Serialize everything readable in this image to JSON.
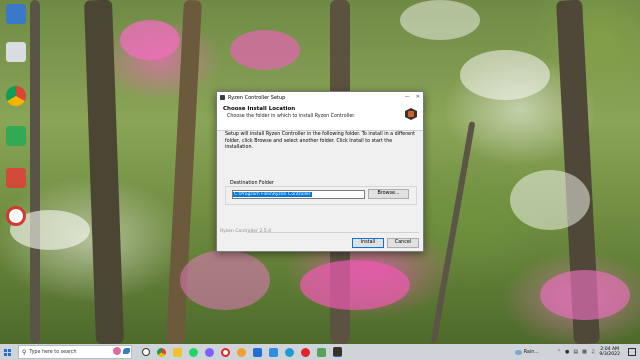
{
  "dialog": {
    "window_title": "Ryzen Controller Setup",
    "header_title": "Choose Install Location",
    "header_subtitle": "Choose the folder in which to install Ryzen Controller.",
    "body_text": "Setup will install Ryzen Controller in the following folder. To install in a different folder, click Browse and select another folder. Click Install to start the installation.",
    "destination_label": "Destination Folder",
    "destination_path": "C:\\Program Files\\Ryzen Controller",
    "browse_label": "Browse...",
    "footer_label": "Ryzen Controller 2.5.4",
    "install_label": "Install",
    "cancel_label": "Cancel"
  },
  "taskbar": {
    "search_placeholder": "Type here to search",
    "weather": "Rain...",
    "time": "2:04 AM",
    "date": "9/3/2022",
    "icons": [
      "task-view-icon",
      "chrome-icon",
      "file-explorer-icon",
      "whatsapp-icon",
      "messenger-icon",
      "opera-icon",
      "app-icon",
      "teamviewer-icon",
      "store-icon",
      "edge-icon",
      "youtube-icon",
      "app-icon-2",
      "ryzen-controller-icon"
    ]
  },
  "colors": {
    "accent": "#0078d7",
    "dialog_bg": "#f0f0f0",
    "taskbar_bg": "#cfd4d8"
  }
}
